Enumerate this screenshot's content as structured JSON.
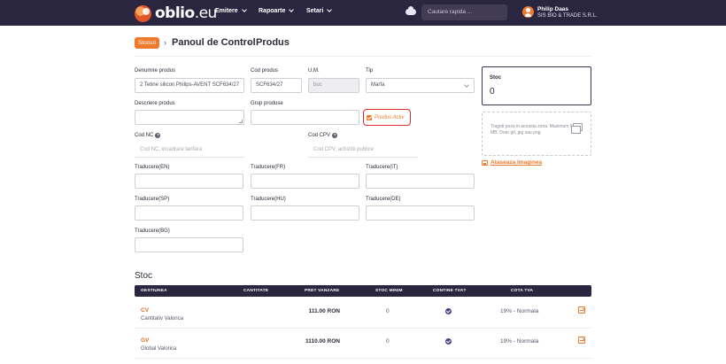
{
  "nav": {
    "logo_main": "oblio",
    "logo_tld": ".eu",
    "menu": [
      {
        "label": "Emitere"
      },
      {
        "label": "Rapoarte"
      },
      {
        "label": "Setari"
      }
    ],
    "search_placeholder": "Cautare rapida ...",
    "user_name": "Philip Daas",
    "user_company": "SIS BIO & TRADE S.R.L.",
    "icons": [
      "cloud-icon",
      "avatar-icon",
      "chevron-down-icon"
    ]
  },
  "breadcrumb": {
    "badge": "Stocuri",
    "items": [
      "Panoul de Control",
      "Produs"
    ]
  },
  "form": {
    "denumire": {
      "label": "Denumire produs",
      "value": "2 Tetine silicon Philips-AVENT SCF634/27"
    },
    "cod": {
      "label": "Cod produs",
      "value": "SCF634/27"
    },
    "um": {
      "label": "U.M.",
      "value": "buc"
    },
    "tip": {
      "label": "Tip",
      "value": "Marfa"
    },
    "descriere": {
      "label": "Descriere produs",
      "value": ""
    },
    "grup": {
      "label": "Grup produse",
      "value": ""
    },
    "activ": {
      "label": "Produs Activ",
      "checked": true
    },
    "cod_nc": {
      "label": "Cod NC",
      "placeholder": "Cod NC, incadrare tarifara"
    },
    "cod_cpv": {
      "label": "Cod CPV",
      "placeholder": "Cod CPV, achizitii publice"
    },
    "traduceri": [
      {
        "label": "Traducere(EN)",
        "value": ""
      },
      {
        "label": "Traducere(FR)",
        "value": ""
      },
      {
        "label": "Traducere(IT)",
        "value": ""
      },
      {
        "label": "Traducere(SP)",
        "value": ""
      },
      {
        "label": "Traducere(HU)",
        "value": ""
      },
      {
        "label": "Traducere(DE)",
        "value": ""
      },
      {
        "label": "Traducere(BG)",
        "value": ""
      }
    ]
  },
  "side": {
    "stoc_title": "Stoc",
    "stoc_value": "0",
    "drop_text": "Trageti poza in aceasta zona. Maximum 5 MB. Doar gif, jpg sau png.",
    "attach_label": "Ataseaza Imaginea"
  },
  "stoc_table": {
    "title": "Stoc",
    "headers": [
      "GESTIUNEA",
      "CANTITATE",
      "PRET VANZARE",
      "STOC MINIM",
      "CONTINE TVA?",
      "COTA TVA"
    ],
    "rows": [
      {
        "code": "CV",
        "name": "Cantitativ Valorica",
        "price": "111.00 RON",
        "stoc_min": "0",
        "contine_tva": true,
        "cota": "19% - Normala"
      },
      {
        "code": "GV",
        "name": "Global Valorica",
        "price": "1110.00 RON",
        "stoc_min": "0",
        "contine_tva": true,
        "cota": "19% - Normala"
      }
    ]
  },
  "colors": {
    "nav_bg": "#2b2640",
    "accent": "#ef7a2c",
    "highlight": "#e32b2b"
  }
}
